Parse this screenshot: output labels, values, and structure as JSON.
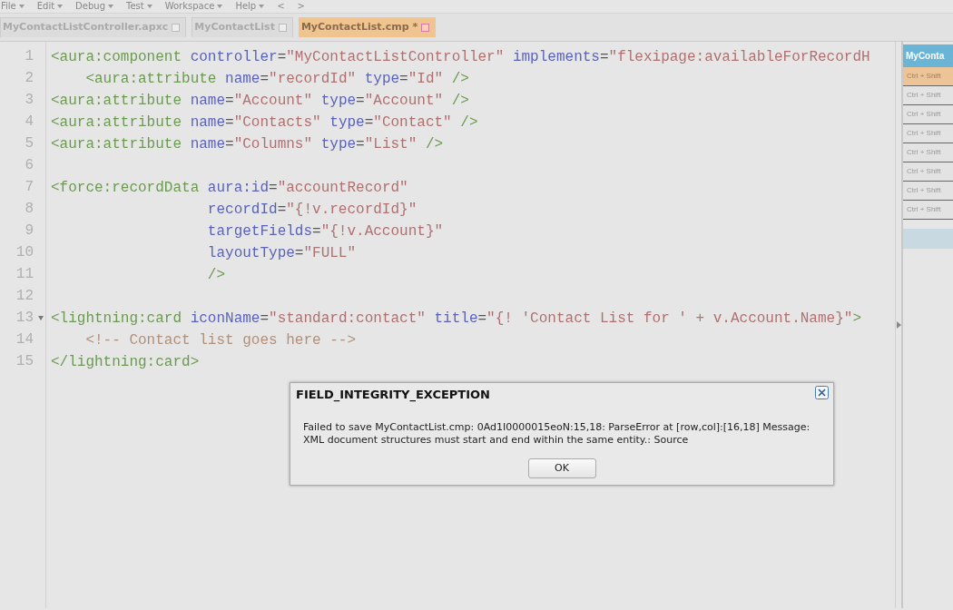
{
  "menu": [
    {
      "label": "File"
    },
    {
      "label": "Edit"
    },
    {
      "label": "Debug"
    },
    {
      "label": "Test"
    },
    {
      "label": "Workspace"
    },
    {
      "label": "Help"
    }
  ],
  "nav": [
    "<",
    ">"
  ],
  "tabs": [
    {
      "label": "MyContactListController.apxc",
      "selected": false
    },
    {
      "label": "MyContactList",
      "selected": false
    },
    {
      "label": "MyContactList.cmp *",
      "selected": true
    }
  ],
  "editor": {
    "lines": [
      {
        "number": "1",
        "tokens": [
          {
            "kind": "tag",
            "text": "<aura:component"
          },
          {
            "kind": "attr",
            "text": " controller"
          },
          {
            "kind": "plain",
            "text": "="
          },
          {
            "kind": "str",
            "text": "\"MyContactListController\""
          },
          {
            "kind": "attr",
            "text": " implements"
          },
          {
            "kind": "plain",
            "text": "="
          },
          {
            "kind": "str",
            "text": "\"flexipage:availableForRecordH"
          }
        ]
      },
      {
        "number": "2",
        "tokens": [
          {
            "kind": "tag",
            "text": "    <aura:attribute"
          },
          {
            "kind": "attr",
            "text": " name"
          },
          {
            "kind": "plain",
            "text": "="
          },
          {
            "kind": "str",
            "text": "\"recordId\""
          },
          {
            "kind": "attr",
            "text": " type"
          },
          {
            "kind": "plain",
            "text": "="
          },
          {
            "kind": "str",
            "text": "\"Id\""
          },
          {
            "kind": "tag",
            "text": " />"
          }
        ]
      },
      {
        "number": "3",
        "tokens": [
          {
            "kind": "tag",
            "text": "<aura:attribute"
          },
          {
            "kind": "attr",
            "text": " name"
          },
          {
            "kind": "plain",
            "text": "="
          },
          {
            "kind": "str",
            "text": "\"Account\""
          },
          {
            "kind": "attr",
            "text": " type"
          },
          {
            "kind": "plain",
            "text": "="
          },
          {
            "kind": "str",
            "text": "\"Account\""
          },
          {
            "kind": "tag",
            "text": " />"
          }
        ]
      },
      {
        "number": "4",
        "tokens": [
          {
            "kind": "tag",
            "text": "<aura:attribute"
          },
          {
            "kind": "attr",
            "text": " name"
          },
          {
            "kind": "plain",
            "text": "="
          },
          {
            "kind": "str",
            "text": "\"Contacts\""
          },
          {
            "kind": "attr",
            "text": " type"
          },
          {
            "kind": "plain",
            "text": "="
          },
          {
            "kind": "str",
            "text": "\"Contact\""
          },
          {
            "kind": "tag",
            "text": " />"
          }
        ]
      },
      {
        "number": "5",
        "tokens": [
          {
            "kind": "tag",
            "text": "<aura:attribute"
          },
          {
            "kind": "attr",
            "text": " name"
          },
          {
            "kind": "plain",
            "text": "="
          },
          {
            "kind": "str",
            "text": "\"Columns\""
          },
          {
            "kind": "attr",
            "text": " type"
          },
          {
            "kind": "plain",
            "text": "="
          },
          {
            "kind": "str",
            "text": "\"List\""
          },
          {
            "kind": "tag",
            "text": " />"
          }
        ]
      },
      {
        "number": "6"
      },
      {
        "number": "7",
        "tokens": [
          {
            "kind": "tag",
            "text": "<force:recordData"
          },
          {
            "kind": "attr",
            "text": " aura:id"
          },
          {
            "kind": "plain",
            "text": "="
          },
          {
            "kind": "str",
            "text": "\"accountRecord\""
          }
        ]
      },
      {
        "number": "8",
        "tokens": [
          {
            "kind": "attr",
            "text": "                  recordId"
          },
          {
            "kind": "plain",
            "text": "="
          },
          {
            "kind": "str",
            "text": "\"{!v.recordId}\""
          }
        ]
      },
      {
        "number": "9",
        "tokens": [
          {
            "kind": "attr",
            "text": "                  targetFields"
          },
          {
            "kind": "plain",
            "text": "="
          },
          {
            "kind": "str",
            "text": "\"{!v.Account}\""
          }
        ]
      },
      {
        "number": "10",
        "tokens": [
          {
            "kind": "attr",
            "text": "                  layoutType"
          },
          {
            "kind": "plain",
            "text": "="
          },
          {
            "kind": "str",
            "text": "\"FULL\""
          }
        ]
      },
      {
        "number": "11",
        "tokens": [
          {
            "kind": "tag",
            "text": "                  />"
          }
        ]
      },
      {
        "number": "12"
      },
      {
        "number": "13",
        "foldable": true,
        "tokens": [
          {
            "kind": "tag",
            "text": "<lightning:card"
          },
          {
            "kind": "attr",
            "text": " iconName"
          },
          {
            "kind": "plain",
            "text": "="
          },
          {
            "kind": "str",
            "text": "\"standard:contact\""
          },
          {
            "kind": "attr",
            "text": " title"
          },
          {
            "kind": "plain",
            "text": "="
          },
          {
            "kind": "str",
            "text": "\"{! 'Contact List for ' + v.Account.Name}\""
          },
          {
            "kind": "tag",
            "text": ">"
          }
        ]
      },
      {
        "number": "14",
        "tokens": [
          {
            "kind": "comment",
            "text": "    <!-- Contact list goes here -->"
          }
        ]
      },
      {
        "number": "15",
        "tokens": [
          {
            "kind": "tag",
            "text": "</lightning:card>"
          }
        ]
      }
    ]
  },
  "side_panel": {
    "title": "MyConta",
    "rows": [
      {
        "label": "Ctrl + Shift",
        "selected": true
      },
      {
        "label": "Ctrl + Shift",
        "selected": false
      },
      {
        "label": "Ctrl + Shift",
        "selected": false
      },
      {
        "label": "Ctrl + Shift",
        "selected": false
      },
      {
        "label": "Ctrl + Shift",
        "selected": false
      },
      {
        "label": "Ctrl + Shift",
        "selected": false
      },
      {
        "label": "Ctrl + Shift",
        "selected": false
      },
      {
        "label": "Ctrl + Shift",
        "selected": false
      }
    ]
  },
  "dialog": {
    "title": "FIELD_INTEGRITY_EXCEPTION",
    "message": "Failed to save MyContactList.cmp: 0Ad1I0000015eoN:15,18: ParseError at [row,col]:[16,18] Message: XML document structures must start and end within the same entity.: Source",
    "button": "OK"
  }
}
